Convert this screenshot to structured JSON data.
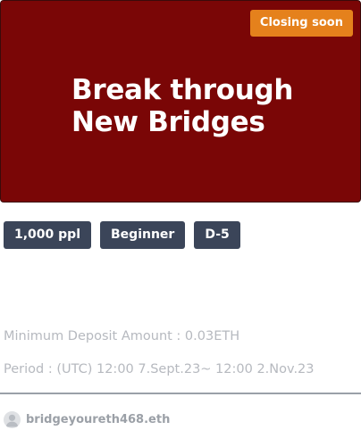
{
  "hero": {
    "title": "Break through New Bridges",
    "background_color": "#7a0606",
    "badge_label": "Closing soon",
    "badge_color": "#e5811c"
  },
  "tags": [
    {
      "label": "1,000 ppl"
    },
    {
      "label": "Beginner"
    },
    {
      "label": "D-5"
    }
  ],
  "tag_color": "#3b4559",
  "details": {
    "min_deposit": "Minimum Deposit Amount : 0.03ETH",
    "period": "Period : (UTC) 12:00 7.Sept.23~ 12:00 2.Nov.23"
  },
  "owner": {
    "name": "bridgeyoureth468.eth",
    "avatar_icon": "user-avatar-icon"
  }
}
